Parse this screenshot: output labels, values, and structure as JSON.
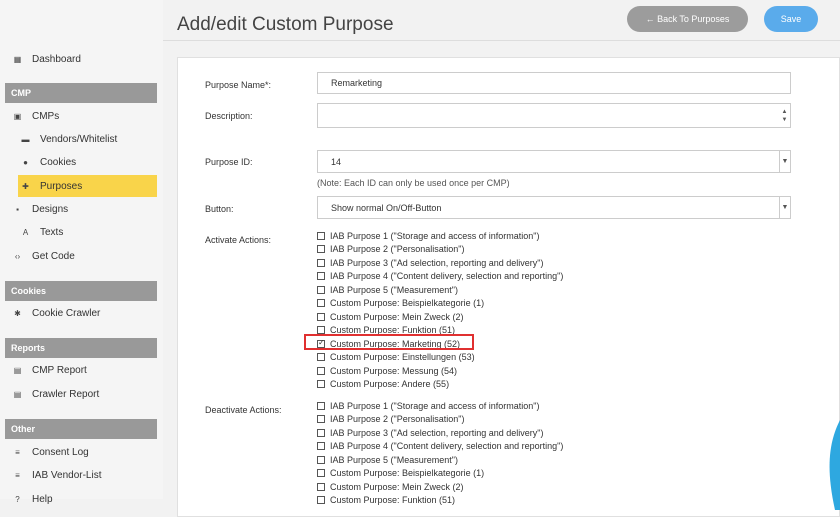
{
  "sidebar": {
    "dashboard": "Dashboard",
    "sections": {
      "cmp": "CMP",
      "cookies": "Cookies",
      "reports": "Reports",
      "other": "Other"
    },
    "items": {
      "cmps": "CMPs",
      "vendors": "Vendors/Whitelist",
      "cookies": "Cookies",
      "purposes": "Purposes",
      "designs": "Designs",
      "texts": "Texts",
      "getcode": "Get Code",
      "crawler": "Cookie Crawler",
      "cmp_report": "CMP Report",
      "crawler_report": "Crawler Report",
      "consent_log": "Consent Log",
      "iab_vendor": "IAB Vendor-List",
      "help": "Help"
    }
  },
  "header": {
    "title": "Add/edit Custom Purpose",
    "back_label": "← Back To Purposes",
    "save_label": "Save"
  },
  "form": {
    "purpose_name_label": "Purpose Name*:",
    "purpose_name_value": "Remarketing",
    "description_label": "Description:",
    "purpose_id_label": "Purpose ID:",
    "purpose_id_value": "14",
    "purpose_id_note": "(Note: Each ID can only be used once per CMP)",
    "button_label": "Button:",
    "button_value": "Show normal On/Off-Button",
    "activate_label": "Activate Actions:",
    "deactivate_label": "Deactivate Actions:",
    "activate_options": [
      {
        "label": "IAB Purpose 1 (\"Storage and access of information\")",
        "checked": false
      },
      {
        "label": "IAB Purpose 2 (\"Personalisation\")",
        "checked": false
      },
      {
        "label": "IAB Purpose 3 (\"Ad selection, reporting and delivery\")",
        "checked": false
      },
      {
        "label": "IAB Purpose 4 (\"Content delivery, selection and reporting\")",
        "checked": false
      },
      {
        "label": "IAB Purpose 5 (\"Measurement\")",
        "checked": false
      },
      {
        "label": "Custom Purpose: Beispielkategorie (1)",
        "checked": false
      },
      {
        "label": "Custom Purpose: Mein Zweck (2)",
        "checked": false
      },
      {
        "label": "Custom Purpose: Funktion (51)",
        "checked": false
      },
      {
        "label": "Custom Purpose: Marketing (52)",
        "checked": true
      },
      {
        "label": "Custom Purpose: Einstellungen (53)",
        "checked": false
      },
      {
        "label": "Custom Purpose: Messung (54)",
        "checked": false
      },
      {
        "label": "Custom Purpose: Andere (55)",
        "checked": false
      }
    ],
    "deactivate_options": [
      {
        "label": "IAB Purpose 1 (\"Storage and access of information\")",
        "checked": false
      },
      {
        "label": "IAB Purpose 2 (\"Personalisation\")",
        "checked": false
      },
      {
        "label": "IAB Purpose 3 (\"Ad selection, reporting and delivery\")",
        "checked": false
      },
      {
        "label": "IAB Purpose 4 (\"Content delivery, selection and reporting\")",
        "checked": false
      },
      {
        "label": "IAB Purpose 5 (\"Measurement\")",
        "checked": false
      },
      {
        "label": "Custom Purpose: Beispielkategorie (1)",
        "checked": false
      },
      {
        "label": "Custom Purpose: Mein Zweck (2)",
        "checked": false
      },
      {
        "label": "Custom Purpose: Funktion (51)",
        "checked": false
      }
    ]
  },
  "colors": {
    "accent": "#f9d44a",
    "save": "#5aabeb",
    "back": "#9c9c9c",
    "section": "#999999",
    "highlight": "#e03030"
  }
}
